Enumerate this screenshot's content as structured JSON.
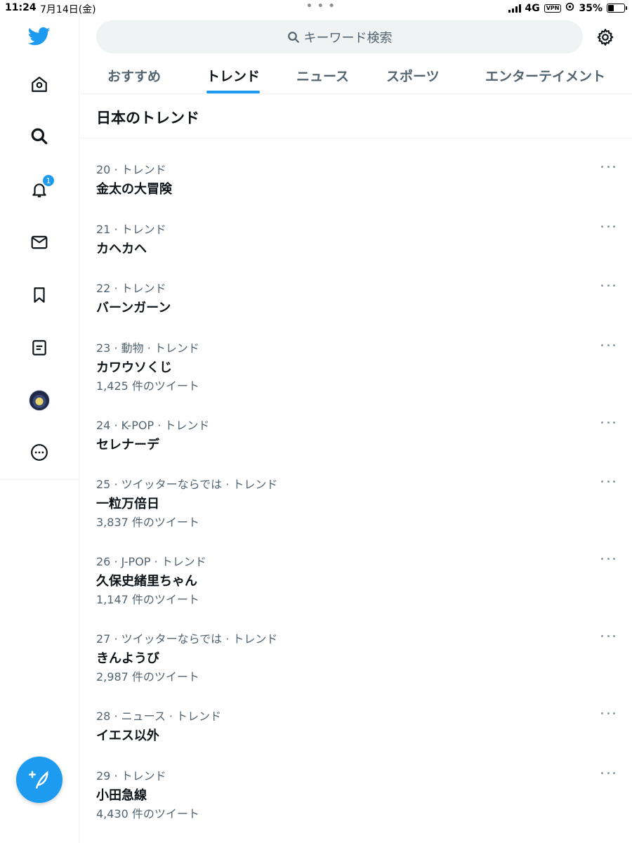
{
  "status_bar": {
    "time": "11:24",
    "date": "7月14日(金)",
    "network": "4G",
    "vpn": "VPN",
    "battery_percent_label": "35%",
    "battery_level": 0.35
  },
  "sidebar": {
    "notification_count": "1",
    "items": [
      "twitter-logo",
      "home-icon",
      "search-icon",
      "bell-icon",
      "mail-icon",
      "bookmark-icon",
      "lists-icon",
      "avatar",
      "more-icon"
    ]
  },
  "search": {
    "placeholder": "キーワード検索"
  },
  "tabs": [
    {
      "label": "おすすめ",
      "active": false
    },
    {
      "label": "トレンド",
      "active": true
    },
    {
      "label": "ニュース",
      "active": false
    },
    {
      "label": "スポーツ",
      "active": false
    },
    {
      "label": "エンターテイメント",
      "active": false
    }
  ],
  "section_title": "日本のトレンド",
  "trends": [
    {
      "meta": "20 · トレンド",
      "name": "金太の大冒険",
      "count": ""
    },
    {
      "meta": "21 · トレンド",
      "name": "カヘカヘ",
      "count": ""
    },
    {
      "meta": "22 · トレンド",
      "name": "バーンガーン",
      "count": ""
    },
    {
      "meta": "23 · 動物 · トレンド",
      "name": "カワウソくじ",
      "count": "1,425 件のツイート"
    },
    {
      "meta": "24 · K-POP · トレンド",
      "name": "セレナーデ",
      "count": ""
    },
    {
      "meta": "25 · ツイッターならでは · トレンド",
      "name": "一粒万倍日",
      "count": "3,837 件のツイート"
    },
    {
      "meta": "26 · J-POP · トレンド",
      "name": "久保史緒里ちゃん",
      "count": "1,147 件のツイート"
    },
    {
      "meta": "27 · ツイッターならでは · トレンド",
      "name": "きんようび",
      "count": "2,987 件のツイート"
    },
    {
      "meta": "28 · ニュース · トレンド",
      "name": "イエス以外",
      "count": ""
    },
    {
      "meta": "29 · トレンド",
      "name": "小田急線",
      "count": "4,430 件のツイート"
    }
  ],
  "colors": {
    "accent": "#1d9bf0",
    "text_primary": "#0f1419",
    "text_secondary": "#536471",
    "divider": "#eff3f4"
  }
}
